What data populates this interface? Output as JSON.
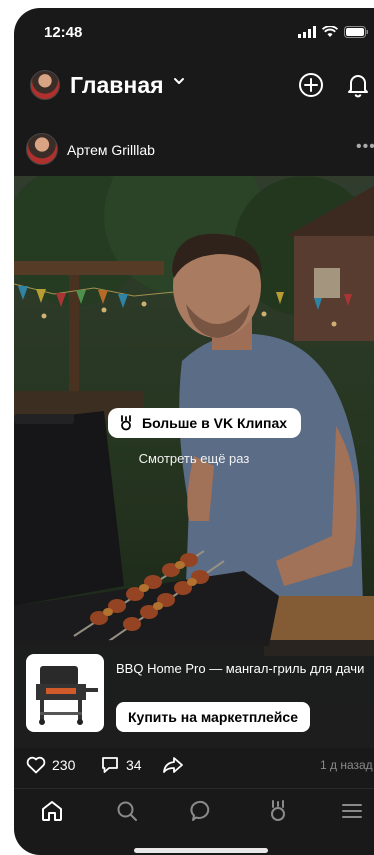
{
  "status_bar": {
    "time": "12:48",
    "icons": [
      "signal-icon",
      "wifi-icon",
      "battery-icon"
    ]
  },
  "header": {
    "title": "Главная",
    "icons": [
      "chevron-down-icon",
      "add-icon",
      "bell-icon"
    ]
  },
  "post": {
    "author": "Артем Grilllab",
    "clips_button": "Больше в VK Клипах",
    "replay": "Смотреть ещё раз",
    "product": {
      "name": "BBQ Home Pro — мангал-гриль для дачи",
      "buy_label": "Купить на маркетплейсе"
    },
    "likes": "230",
    "comments": "34",
    "time": "1 д назад"
  },
  "tabbar": {
    "items": [
      "home-icon",
      "search-icon",
      "messages-icon",
      "clips-icon",
      "menu-icon"
    ]
  },
  "colors": {
    "background": "#19191a",
    "text": "#ffffff",
    "muted": "#8a8a8a"
  }
}
